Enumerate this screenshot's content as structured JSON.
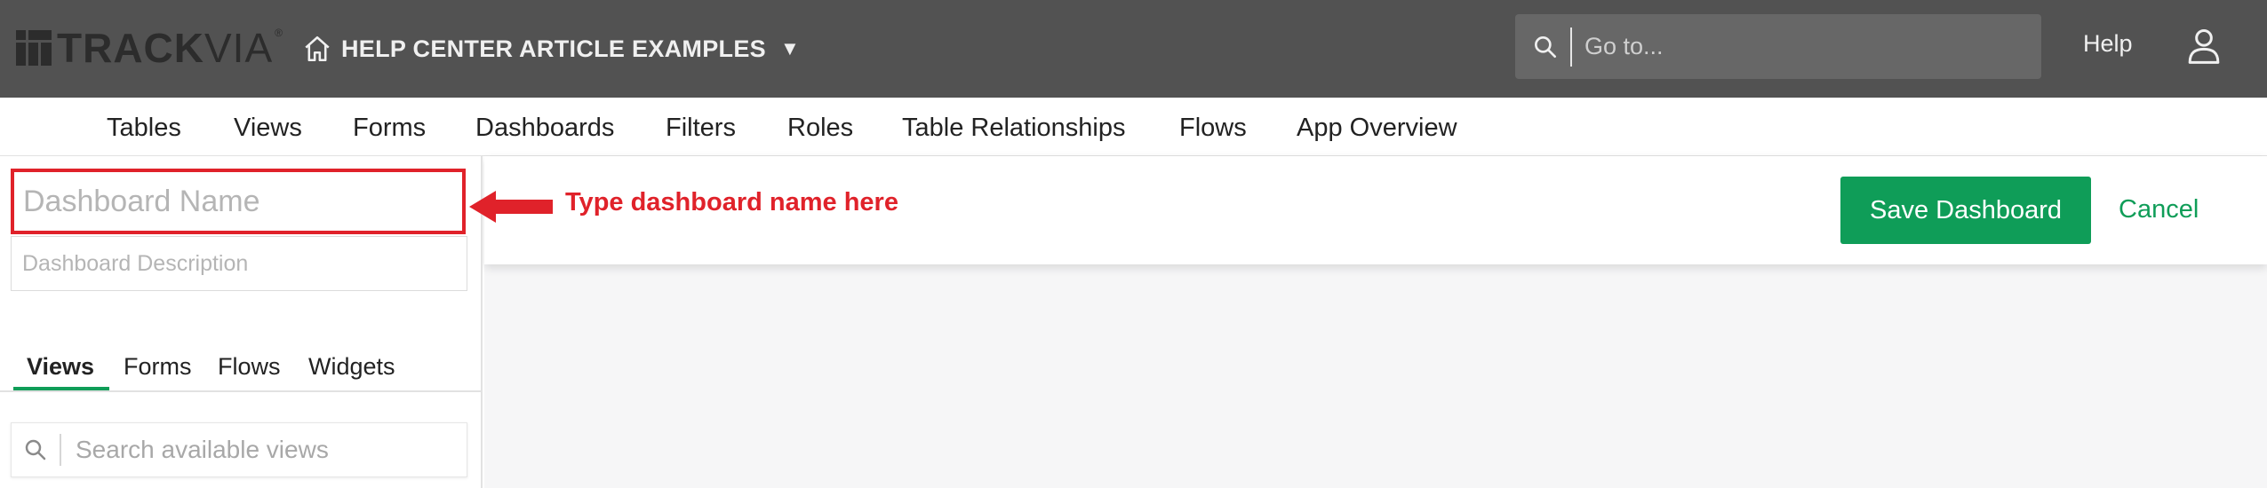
{
  "header": {
    "logo_text_bold": "TRACK",
    "logo_text_light": "VIA",
    "logo_trademark": "®",
    "app_name": "HELP CENTER ARTICLE EXAMPLES",
    "app_caret": "▼",
    "goto_placeholder": "Go to...",
    "help_label": "Help"
  },
  "nav": {
    "items": [
      "Tables",
      "Views",
      "Forms",
      "Dashboards",
      "Filters",
      "Roles",
      "Table Relationships",
      "Flows",
      "App Overview"
    ]
  },
  "left_panel": {
    "name_placeholder": "Dashboard Name",
    "description_placeholder": "Dashboard Description",
    "tabs": [
      "Views",
      "Forms",
      "Flows",
      "Widgets"
    ],
    "active_tab": "Views",
    "search_placeholder": "Search available views"
  },
  "toolbar": {
    "save_label": "Save Dashboard",
    "cancel_label": "Cancel"
  },
  "annotation": {
    "text": "Type dashboard name here"
  },
  "colors": {
    "header_bg": "#525252",
    "accent_green": "#0f9d58",
    "annotation_red": "#e0222a"
  },
  "icons": {
    "home": "home-icon",
    "search": "search-icon",
    "user": "user-icon",
    "caret": "caret-down-icon",
    "arrow": "arrow-left-icon"
  }
}
